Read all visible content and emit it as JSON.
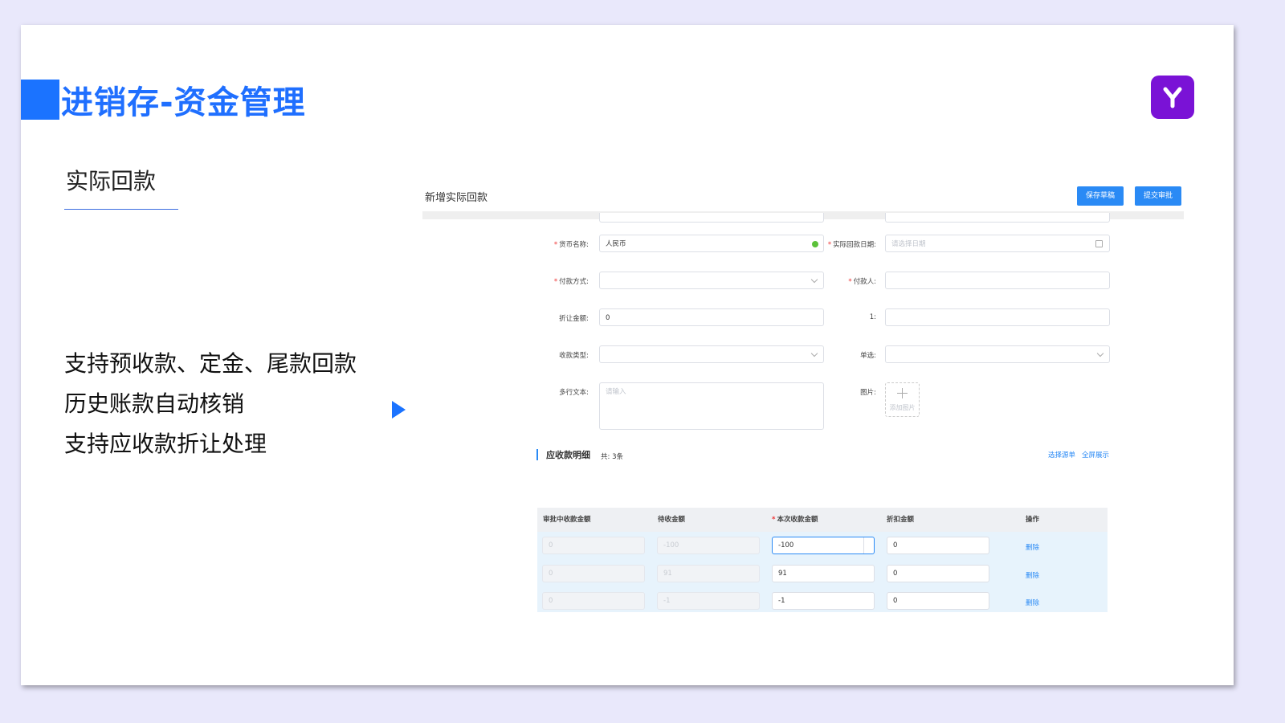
{
  "slide": {
    "title": "进销存-资金管理",
    "section_title": "实际回款",
    "features": [
      "支持预收款、定金、尾款回款",
      "历史账款自动核销",
      "支持应收款折让处理"
    ],
    "logo_icon": "y-letter-icon",
    "accent_color": "#1b73ff",
    "logo_color": "#7a12d6"
  },
  "screenshot": {
    "page_title": "新增实际回款",
    "buttons": {
      "save_draft": "保存草稿",
      "submit": "提交审批"
    },
    "form": {
      "currency": {
        "label": "货币名称:",
        "value": "人民币"
      },
      "actual_date": {
        "label": "实际回款日期:",
        "placeholder": "请选择日期"
      },
      "payment_method": {
        "label": "付款方式:",
        "value": ""
      },
      "payer": {
        "label": "付款人:",
        "value": ""
      },
      "discount_amount": {
        "label": "折让金额:",
        "value": "0"
      },
      "field_1": {
        "label": "1:",
        "value": ""
      },
      "receipt_type": {
        "label": "收款类型:",
        "value": ""
      },
      "single_select": {
        "label": "单选:",
        "value": ""
      },
      "multiline": {
        "label": "多行文本:",
        "placeholder": "请输入"
      },
      "image": {
        "label": "图片:",
        "upload_text": "添加图片"
      }
    },
    "detail": {
      "title": "应收款明细",
      "count": "共: 3条",
      "links": {
        "select_source": "选择源单",
        "fullscreen": "全屏展示"
      },
      "columns": [
        "审批中收款金额",
        "待收金额",
        "本次收款金额",
        "折扣金额",
        "操作"
      ],
      "rows": [
        {
          "pending_approval": "0",
          "to_collect": "-100",
          "this_time": "-100",
          "discount": "0",
          "action": "删除"
        },
        {
          "pending_approval": "0",
          "to_collect": "91",
          "this_time": "91",
          "discount": "0",
          "action": "删除"
        },
        {
          "pending_approval": "0",
          "to_collect": "-1",
          "this_time": "-1",
          "discount": "0",
          "action": "删除"
        }
      ]
    }
  }
}
